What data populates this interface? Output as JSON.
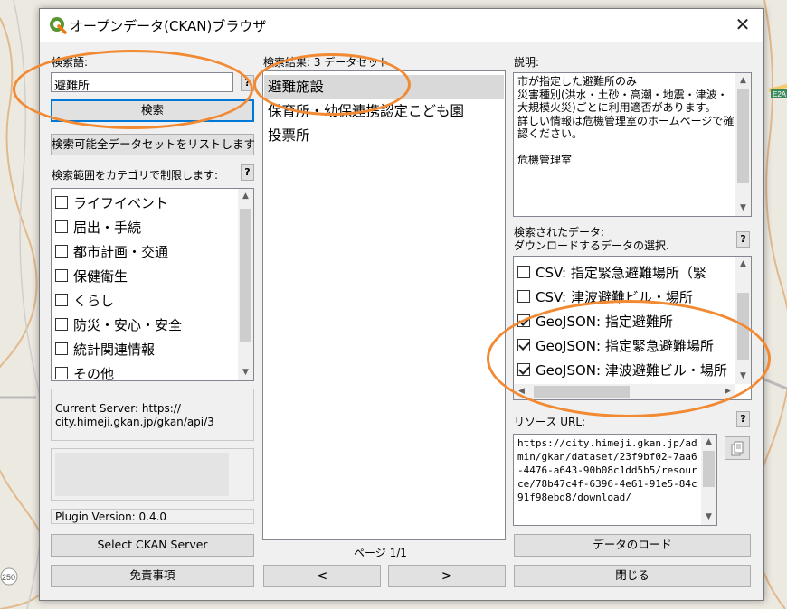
{
  "window": {
    "title": "オープンデータ(CKAN)ブラウザ",
    "close_glyph": "✕"
  },
  "search": {
    "label": "検索語:",
    "value": "避難所",
    "help": "?",
    "button": "検索",
    "list_all_button": "検索可能全データセットをリストします",
    "category_label": "検索範囲をカテゴリで制限します:",
    "category_help": "?"
  },
  "categories": [
    {
      "label": "ライフイベント",
      "checked": false
    },
    {
      "label": "届出・手続",
      "checked": false
    },
    {
      "label": "都市計画・交通",
      "checked": false
    },
    {
      "label": "保健衛生",
      "checked": false
    },
    {
      "label": "くらし",
      "checked": false
    },
    {
      "label": "防災・安心・安全",
      "checked": false
    },
    {
      "label": "統計関連情報",
      "checked": false
    },
    {
      "label": "その他",
      "checked": false
    }
  ],
  "server": {
    "current_text": "Current Server: https://\ncity.himeji.gkan.jp/gkan/api/3",
    "plugin_version": "Plugin Version: 0.4.0",
    "select_button": "Select CKAN Server",
    "disclaimer_button": "免責事項"
  },
  "results": {
    "label": "検索結果: 3 データセット",
    "items": [
      {
        "label": "避難施設",
        "selected": true
      },
      {
        "label": "保育所・幼保連携認定こども園",
        "selected": false
      },
      {
        "label": "投票所",
        "selected": false
      }
    ],
    "page_label": "ページ 1/1",
    "prev": "<",
    "next": ">"
  },
  "description": {
    "label": "説明:",
    "text": "市が指定した避難所のみ\n災害種別(洪水・土砂・高潮・地震・津波・大規模火災)ごとに利用適否があります。\n詳しい情報は危機管理室のホームページで確認ください。\n\n危機管理室\n"
  },
  "data": {
    "label_line1": "検索されたデータ:",
    "label_line2": "ダウンロードするデータの選択.",
    "help": "?",
    "items": [
      {
        "label": "CSV: 指定緊急避難場所（緊",
        "checked": false
      },
      {
        "label": "CSV: 津波避難ビル・場所",
        "checked": false
      },
      {
        "label": "GeoJSON: 指定避難所",
        "checked": true
      },
      {
        "label": "GeoJSON: 指定緊急避難場所",
        "checked": true
      },
      {
        "label": "GeoJSON: 津波避難ビル・場所",
        "checked": true
      }
    ]
  },
  "resource": {
    "label": "リソース URL:",
    "help": "?",
    "url": "https://city.himeji.gkan.jp/admin/gkan/dataset/23f9bf02-7aa6-4476-a643-90b08c1dd5b5/resource/78b47c4f-6396-4e61-91e5-84c91f98ebd8/download/",
    "copy_icon": "copy-icon"
  },
  "buttons": {
    "load_data": "データのロード",
    "close": "閉じる"
  },
  "colors": {
    "annotation": "#f28a34",
    "accent": "#0078d7",
    "selection": "#d9d9d9"
  },
  "map_labels": {
    "road_badge": "E2A",
    "road_number": "250"
  }
}
